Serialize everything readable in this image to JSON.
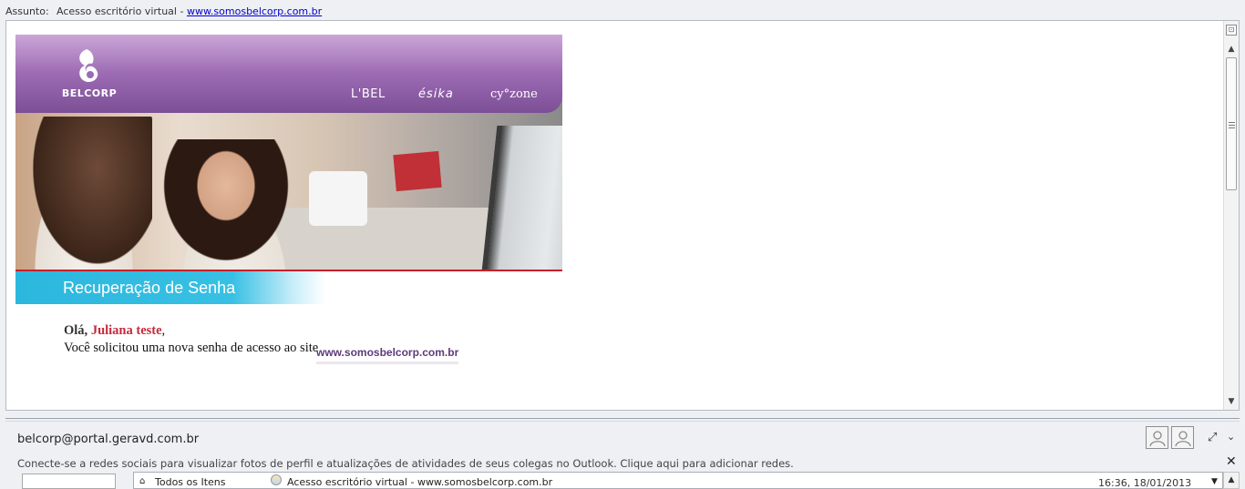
{
  "subject": {
    "label": "Assunto:",
    "text": "Acesso escritório virtual - ",
    "link": "www.somosbelcorp.com.br"
  },
  "banner": {
    "logo_text": "BELCORP",
    "brands": [
      "L'BEL",
      "ésika",
      "cy°zone"
    ],
    "subtitle": "Recuperação de Senha"
  },
  "body": {
    "greeting_hello": "Olá,",
    "greeting_name": "Juliana teste",
    "greeting_comma": ",",
    "message": "Você solicitou uma nova senha de acesso ao site",
    "site_link": "www.somosbelcorp.com.br"
  },
  "sender": {
    "email": "belcorp@portal.geravd.com.br"
  },
  "social": {
    "message": "Conecte-se a redes sociais para visualizar fotos de perfil e atualizações de atividades de seus colegas no Outlook. Clique aqui para adicionar redes."
  },
  "bottom_list": {
    "folder": "Todos os Itens",
    "subject": "Acesso escritório virtual - www.somosbelcorp.com.br",
    "date": "16:36, 18/01/2013"
  },
  "icons": {
    "expand": "expand-icon",
    "chevron": "chevron-down-icon",
    "close": "close-icon"
  },
  "colors": {
    "link": "#0000cc",
    "banner_purple": "#8a5aa4",
    "subtitle_cyan": "#2cb7de",
    "name_red": "#c62a3c",
    "site_purple": "#5e3a7a"
  }
}
